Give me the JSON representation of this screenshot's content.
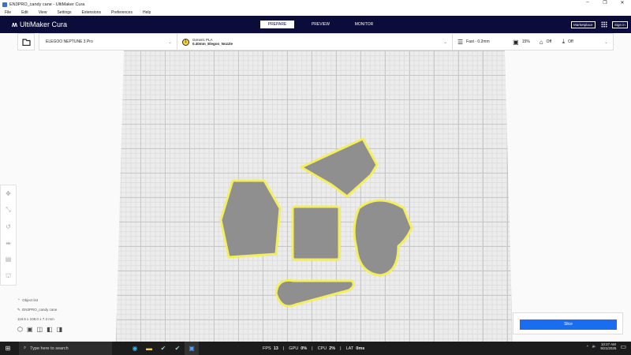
{
  "window": {
    "title": "EN3PRO_candy cane - UltiMaker Cura",
    "minimize": "–",
    "restore": "❐",
    "close": "✕"
  },
  "menu": [
    "File",
    "Edit",
    "View",
    "Settings",
    "Extensions",
    "Preferences",
    "Help"
  ],
  "header": {
    "logo": "UltiMaker Cura",
    "tabs": [
      "PREPARE",
      "PREVIEW",
      "MONITOR"
    ],
    "marketplace": "Marketplace",
    "signin": "Sign in"
  },
  "printer": {
    "name": "ELEGOO NEPTUNE 3 Pro"
  },
  "material": {
    "type": "Generic PLA",
    "nozzle": "0.40mm_Elegoo_Nozzle",
    "icon_label": "1"
  },
  "settings": {
    "profile": "Fast - 0.2mm",
    "infill": "15%",
    "support": "Off",
    "adhesion": "Off"
  },
  "objects": {
    "header": "Object list",
    "name": "EN3PRO_candy cane",
    "dimensions": "119.5 x 108.0 x 7.3 mm"
  },
  "slice": {
    "label": "Slice"
  },
  "taskbar": {
    "search": "Type here to search",
    "fps_label": "FPS",
    "fps": "13",
    "gpu_label": "GPU",
    "gpu": "0%",
    "cpu_label": "CPU",
    "cpu": "2%",
    "lat_label": "LAT",
    "lat": "0ms",
    "time": "10:27 AM",
    "date": "9/21/2025"
  },
  "colors": {
    "header": "#0c0c3a",
    "accent": "#196ef0",
    "model_outline": "#f3ef5c",
    "model_fill": "#8f8f8f"
  }
}
